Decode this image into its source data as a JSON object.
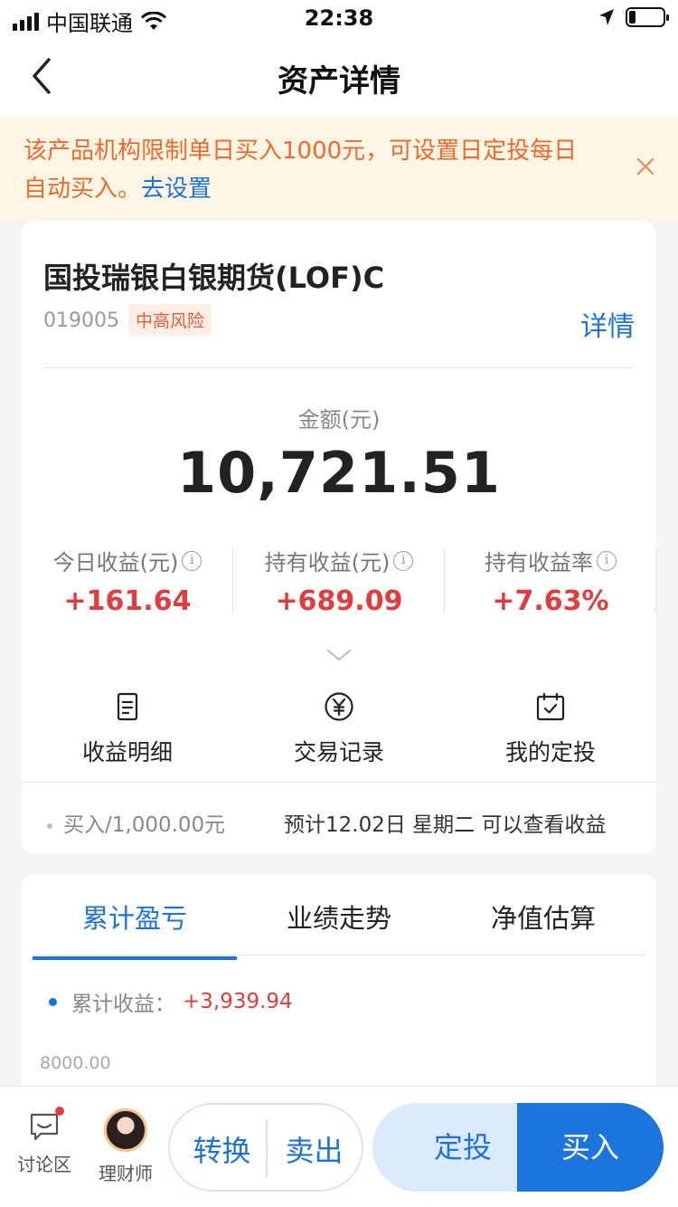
{
  "status_bar": {
    "carrier": "中国联通",
    "time": "22:38",
    "battery_level": 0.2
  },
  "nav": {
    "title": "资产详情",
    "back_icon": "chevron-left-icon"
  },
  "notice": {
    "text": "该产品机构限制单日买入1000元，可设置日定投每日自动买入。",
    "link": "去设置",
    "close_icon": "close-icon"
  },
  "fund": {
    "name": "国投瑞银白银期货(LOF)C",
    "code": "019005",
    "risk": "中高风险",
    "detail_link": "详情"
  },
  "amount": {
    "label": "金额(元)",
    "value": "10,721.51"
  },
  "stats": [
    {
      "label": "今日收益(元)",
      "value": "+161.64"
    },
    {
      "label": "持有收益(元)",
      "value": "+689.09"
    },
    {
      "label": "持有收益率",
      "value": "+7.63%"
    }
  ],
  "info_glyph": "i",
  "actions": [
    {
      "label": "收益明细",
      "icon": "document-icon"
    },
    {
      "label": "交易记录",
      "icon": "yuan-circle-icon"
    },
    {
      "label": "我的定投",
      "icon": "calendar-check-icon"
    }
  ],
  "buy_info": {
    "left": "买入/1,000.00元",
    "right": "预计12.02日 星期二 可以查看收益"
  },
  "chart_tabs": [
    {
      "label": "累计盈亏",
      "active": true
    },
    {
      "label": "业绩走势",
      "active": false
    },
    {
      "label": "净值估算",
      "active": false
    }
  ],
  "cumulative": {
    "label": "累计收益：",
    "value": "+3,939.94"
  },
  "chart_y_tick": "8000.00",
  "bottom_bar": {
    "discuss_label": "讨论区",
    "advisor_label": "理财师",
    "convert_label": "转换",
    "sell_label": "卖出",
    "auto_invest_label": "定投",
    "buy_label": "买入"
  },
  "colors": {
    "accent": "#1e73d8",
    "gain": "#e23c3c",
    "notice_text": "#ee6a2e",
    "notice_bg": "#fdf6e5"
  }
}
